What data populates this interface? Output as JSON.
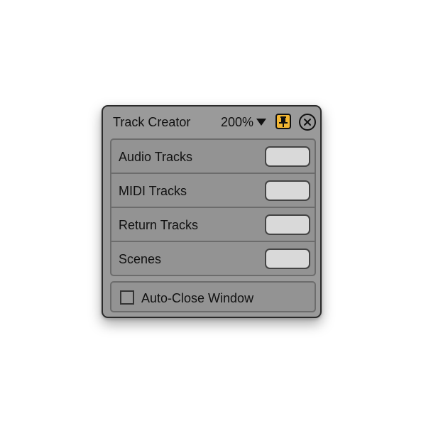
{
  "window": {
    "title": "Track Creator",
    "zoom": "200%",
    "pinned": true
  },
  "icons": {
    "zoom_dropdown": "triangle-down",
    "pin": "pin-icon",
    "close": "close-x-icon"
  },
  "colors": {
    "pin_active": "#f2b632",
    "window_bg": "#9a9a9a",
    "field_bg": "#d9d9d9"
  },
  "rows": [
    {
      "label": "Audio Tracks",
      "value": ""
    },
    {
      "label": "MIDI Tracks",
      "value": ""
    },
    {
      "label": "Return Tracks",
      "value": ""
    },
    {
      "label": "Scenes",
      "value": ""
    }
  ],
  "auto_close": {
    "label": "Auto-Close Window",
    "checked": false
  }
}
